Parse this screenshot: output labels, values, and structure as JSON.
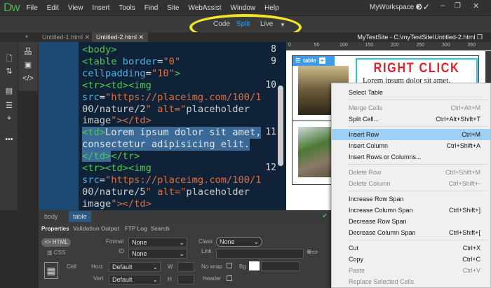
{
  "app": {
    "logo": "Dw",
    "menus": [
      "File",
      "Edit",
      "View",
      "Insert",
      "Tools",
      "Find",
      "Site",
      "WebAssist",
      "Window",
      "Help"
    ],
    "workspace": "MyWorkspace"
  },
  "views": {
    "code": "Code",
    "split": "Split",
    "live": "Live"
  },
  "tabs": [
    {
      "label": "Untitled-1.html"
    },
    {
      "label": "Untitled-2.html"
    }
  ],
  "site_path": "MyTestSite - C:\\myTestSite\\Untitled-2.html",
  "ruler": [
    "0",
    "50",
    "100",
    "150",
    "200",
    "250",
    "300",
    "350"
  ],
  "code": {
    "line_numbers": [
      "8",
      "9",
      "10",
      "11",
      "12"
    ],
    "lines": [
      "<body>",
      "<table border=\"0\"",
      "cellpadding=\"10\">",
      "<tr><td><img",
      "src=\"https://placeimg.com/100/1",
      "00/nature/2\" alt=\"placeholder",
      "image\"></td>",
      "<td>Lorem ipsum dolor sit amet,",
      "consectetur adipisicing elit.",
      "</td></tr>",
      "<tr><td><img",
      "src=\"https://placeimg.com/100/1",
      "00/nature/5\" alt=\"placeholder",
      "image\"></td>"
    ]
  },
  "live": {
    "table_badge": "table",
    "heading": "RIGHT CLICK",
    "cell_text": "Lorem ipsum dolor sit amet,"
  },
  "tagbar": [
    "body",
    "table"
  ],
  "panel_tabs": [
    "Properties",
    "Validation",
    "Output",
    "FTP Log",
    "Search"
  ],
  "props": {
    "html": "HTML",
    "css": "CSS",
    "format_label": "Format",
    "format": "None",
    "id_label": "ID",
    "id": "None",
    "class_label": "Class",
    "class": "None",
    "link_label": "Link",
    "cell_label": "Cell",
    "horz_label": "Horz",
    "horz": "Default",
    "vert_label": "Vert",
    "vert": "Default",
    "w_label": "W",
    "h_label": "H",
    "nowrap_label": "No wrap",
    "header_label": "Header",
    "bg_label": "Bg"
  },
  "context_menu": [
    {
      "label": "Select Table",
      "shortcut": "",
      "disabled": false
    },
    {
      "sep": true
    },
    {
      "label": "Merge Cells",
      "shortcut": "Ctrl+Alt+M",
      "disabled": true
    },
    {
      "label": "Split Cell...",
      "shortcut": "Ctrl+Alt+Shift+T",
      "disabled": false
    },
    {
      "sep": true
    },
    {
      "label": "Insert Row",
      "shortcut": "Ctrl+M",
      "disabled": false,
      "highlighted": true
    },
    {
      "label": "Insert Column",
      "shortcut": "Ctrl+Shift+A",
      "disabled": false
    },
    {
      "label": "Insert Rows or Columns...",
      "shortcut": "",
      "disabled": false
    },
    {
      "sep": true
    },
    {
      "label": "Delete Row",
      "shortcut": "Ctrl+Shift+M",
      "disabled": true
    },
    {
      "label": "Delete Column",
      "shortcut": "Ctrl+Shift+-",
      "disabled": true
    },
    {
      "sep": true
    },
    {
      "label": "Increase Row Span",
      "shortcut": "",
      "disabled": false
    },
    {
      "label": "Increase Column Span",
      "shortcut": "Ctrl+Shift+]",
      "disabled": false
    },
    {
      "label": "Decrease Row Span",
      "shortcut": "",
      "disabled": false
    },
    {
      "label": "Decrease Column Span",
      "shortcut": "Ctrl+Shift+[",
      "disabled": false
    },
    {
      "sep": true
    },
    {
      "label": "Cut",
      "shortcut": "Ctrl+X",
      "disabled": false
    },
    {
      "label": "Copy",
      "shortcut": "Ctrl+C",
      "disabled": false
    },
    {
      "label": "Paste",
      "shortcut": "Ctrl+V",
      "disabled": true
    },
    {
      "label": "Replace Selected Cells",
      "shortcut": "",
      "disabled": true
    }
  ],
  "colors": {
    "accent": "#3d9be9",
    "highlight_ellipse": "#f1e52a",
    "heading": "#e0202a",
    "menu_highlight": "#9fd0f5"
  }
}
